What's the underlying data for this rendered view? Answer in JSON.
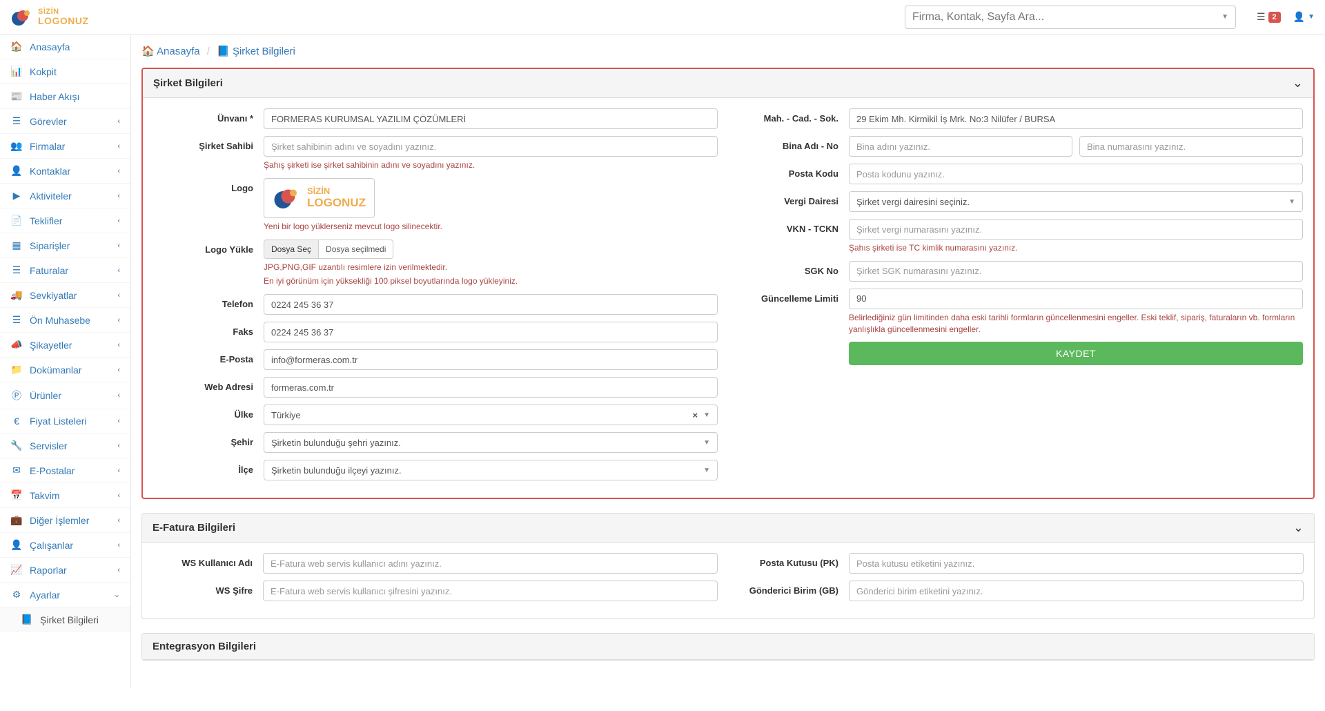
{
  "header": {
    "logo_line1": "SİZİN",
    "logo_line2": "LOGONUZ",
    "search_placeholder": "Firma, Kontak, Sayfa Ara...",
    "badge_count": "2"
  },
  "sidebar": {
    "items": [
      {
        "icon": "home",
        "label": "Anasayfa",
        "chev": false
      },
      {
        "icon": "dashboard",
        "label": "Kokpit",
        "chev": false
      },
      {
        "icon": "news",
        "label": "Haber Akışı",
        "chev": false
      },
      {
        "icon": "tasks",
        "label": "Görevler",
        "chev": true
      },
      {
        "icon": "users",
        "label": "Firmalar",
        "chev": true
      },
      {
        "icon": "user",
        "label": "Kontaklar",
        "chev": true
      },
      {
        "icon": "play",
        "label": "Aktiviteler",
        "chev": true
      },
      {
        "icon": "file",
        "label": "Teklifler",
        "chev": true
      },
      {
        "icon": "calendar-grid",
        "label": "Siparişler",
        "chev": true
      },
      {
        "icon": "list",
        "label": "Faturalar",
        "chev": true
      },
      {
        "icon": "truck",
        "label": "Sevkiyatlar",
        "chev": true
      },
      {
        "icon": "list",
        "label": "Ön Muhasebe",
        "chev": true
      },
      {
        "icon": "bullhorn",
        "label": "Şikayetler",
        "chev": true
      },
      {
        "icon": "folder",
        "label": "Dokümanlar",
        "chev": true
      },
      {
        "icon": "product",
        "label": "Ürünler",
        "chev": true
      },
      {
        "icon": "euro",
        "label": "Fiyat Listeleri",
        "chev": true
      },
      {
        "icon": "wrench",
        "label": "Servisler",
        "chev": true
      },
      {
        "icon": "mail",
        "label": "E-Postalar",
        "chev": true
      },
      {
        "icon": "calendar",
        "label": "Takvim",
        "chev": true
      },
      {
        "icon": "briefcase",
        "label": "Diğer İşlemler",
        "chev": true
      },
      {
        "icon": "user",
        "label": "Çalışanlar",
        "chev": true
      },
      {
        "icon": "chart",
        "label": "Raporlar",
        "chev": true
      },
      {
        "icon": "gear",
        "label": "Ayarlar",
        "chev": true,
        "open": true
      },
      {
        "icon": "book",
        "label": "Şirket Bilgileri",
        "sub": true
      }
    ]
  },
  "breadcrumb": {
    "home": "Anasayfa",
    "current": "Şirket Bilgileri"
  },
  "panel1": {
    "title": "Şirket Bilgileri",
    "left": {
      "unvan_label": "Ünvanı *",
      "unvan_value": "FORMERAS KURUMSAL YAZILIM ÇÖZÜMLERİ",
      "sahip_label": "Şirket Sahibi",
      "sahip_placeholder": "Şirket sahibinin adını ve soyadını yazınız.",
      "sahip_help": "Şahış şirketi ise şirket sahibinin adını ve soyadını yazınız.",
      "logo_label": "Logo",
      "logo_help": "Yeni bir logo yüklerseniz mevcut logo silinecektir.",
      "logo_upload_label": "Logo Yükle",
      "file_btn": "Dosya Seç",
      "file_txt": "Dosya seçilmedi",
      "upload_help1": "JPG,PNG,GIF uzantılı resimlere izin verilmektedir.",
      "upload_help2": "En iyi görünüm için yüksekliği 100 piksel boyutlarında logo yükleyiniz.",
      "telefon_label": "Telefon",
      "telefon_value": "0224 245 36 37",
      "faks_label": "Faks",
      "faks_value": "0224 245 36 37",
      "eposta_label": "E-Posta",
      "eposta_value": "info@formeras.com.tr",
      "web_label": "Web Adresi",
      "web_value": "formeras.com.tr",
      "ulke_label": "Ülke",
      "ulke_value": "Türkiye",
      "sehir_label": "Şehir",
      "sehir_placeholder": "Şirketin bulunduğu şehri yazınız.",
      "ilce_label": "İlçe",
      "ilce_placeholder": "Şirketin bulunduğu ilçeyi yazınız."
    },
    "right": {
      "adres_label": "Mah. - Cad. - Sok.",
      "adres_value": "29 Ekim Mh. Kirmikil İş Mrk. No:3 Nilüfer / BURSA",
      "bina_label": "Bina Adı - No",
      "bina_adi_placeholder": "Bina adını yazınız.",
      "bina_no_placeholder": "Bina numarasını yazınız.",
      "posta_label": "Posta Kodu",
      "posta_placeholder": "Posta kodunu yazınız.",
      "vergi_label": "Vergi Dairesi",
      "vergi_placeholder": "Şirket vergi dairesini seçiniz.",
      "vkn_label": "VKN - TCKN",
      "vkn_placeholder": "Şirket vergi numarasını yazınız.",
      "vkn_help": "Şahıs şirketi ise TC kimlik numarasını yazınız.",
      "sgk_label": "SGK No",
      "sgk_placeholder": "Şirket SGK numarasını yazınız.",
      "limit_label": "Güncelleme Limiti",
      "limit_value": "90",
      "limit_help": "Belirlediğiniz gün limitinden daha eski tarihli formların güncellenmesini engeller. Eski teklif, sipariş, faturaların vb. formların yanlışlıkla güncellenmesini engeller.",
      "save_btn": "KAYDET"
    }
  },
  "panel2": {
    "title": "E-Fatura Bilgileri",
    "ws_user_label": "WS Kullanıcı Adı",
    "ws_user_placeholder": "E-Fatura web servis kullanıcı adını yazınız.",
    "ws_pass_label": "WS Şifre",
    "ws_pass_placeholder": "E-Fatura web servis kullanıcı şifresini yazınız.",
    "pk_label": "Posta Kutusu (PK)",
    "pk_placeholder": "Posta kutusu etiketini yazınız.",
    "gb_label": "Gönderici Birim (GB)",
    "gb_placeholder": "Gönderici birim etiketini yazınız."
  },
  "panel3": {
    "title": "Entegrasyon Bilgileri"
  }
}
